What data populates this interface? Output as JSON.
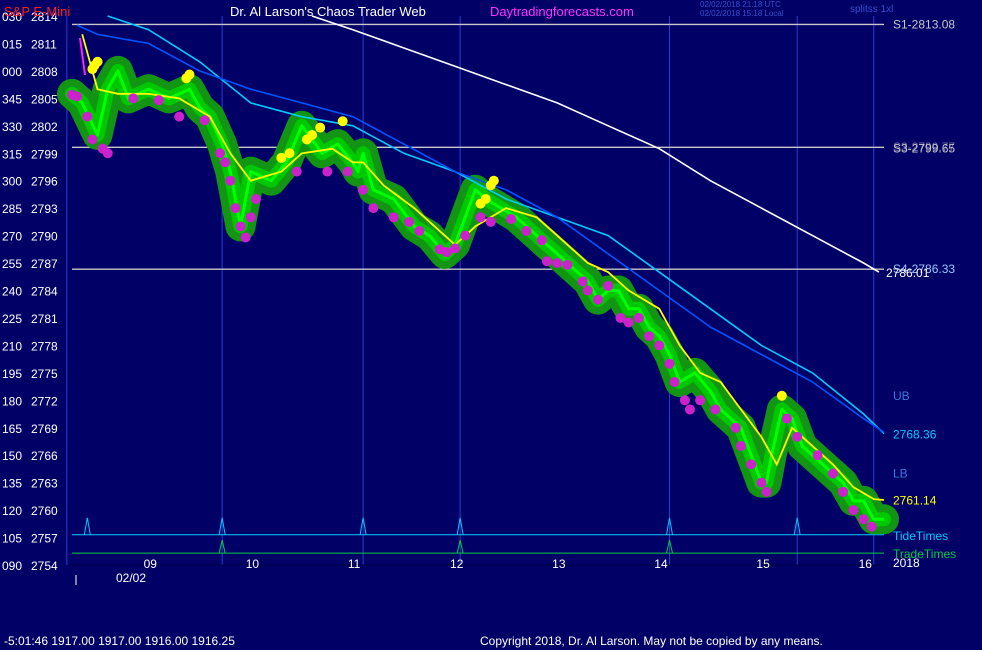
{
  "header": {
    "instrument": "S&P E-Mini",
    "title": "Dr. Al Larson's Chaos Trader Web",
    "site": "Daytradingforecasts.com",
    "timestamp_utc": "02/02/2018 21:18 UTC",
    "timestamp_local": "02/02/2018 15:18 Local",
    "corner_label": "splitss 1xl"
  },
  "footer": {
    "quote": "-5:01:46  1917.00 1917.00 1916.00 1916.25",
    "copyright": "Copyright 2018, Dr. Al Larson. May not be copied by any means."
  },
  "colors": {
    "background": "#000066",
    "price": "#00ff00",
    "glow": "#129512",
    "ema": "#ffff00",
    "upper_band": "#00ccff",
    "lower_band": "#0055ff",
    "slow_ma": "#ffffff",
    "dots_low": "#cc22cc",
    "dots_high": "#ffff00",
    "level_lines": "#c8c8c8",
    "tide": "#00ccff",
    "trade": "#00cc44",
    "grid": "#2a3fd0"
  },
  "chart_data": {
    "type": "line",
    "y_axis": {
      "range": [
        2754,
        2814
      ],
      "ticks": [
        2814,
        2811,
        2808,
        2805,
        2802,
        2799,
        2796,
        2793,
        2790,
        2787,
        2784,
        2781,
        2778,
        2775,
        2772,
        2769,
        2766,
        2763,
        2760,
        2757,
        2754
      ],
      "secondary_labels": [
        "030",
        "015",
        "000",
        "345",
        "330",
        "315",
        "300",
        "285",
        "270",
        "255",
        "240",
        "225",
        "210",
        "195",
        "180",
        "165",
        "150",
        "135",
        "120",
        "105",
        "090"
      ]
    },
    "x_axis": {
      "range": [
        8.25,
        16.2
      ],
      "hour_labels": [
        "09",
        "10",
        "11",
        "12",
        "13",
        "14",
        "15",
        "16"
      ],
      "date_label": "02/02",
      "year_label": "2018"
    },
    "vertical_lines": [
      8.2,
      9.72,
      11.1,
      12.05,
      14.1,
      15.35,
      16.1
    ],
    "tide_times": [
      8.4,
      9.72,
      11.1,
      12.05,
      14.1,
      15.35
    ],
    "trade_times": [
      9.72,
      12.05,
      14.1
    ],
    "levels": [
      {
        "label": "S1-2813.08",
        "value": 2813.08,
        "color": "#c8c8c8"
      },
      {
        "label": "S3-2799.65",
        "value": 2799.65,
        "color": "#c8c8c8"
      },
      {
        "label": "S3-2799.77",
        "value": 2799.77,
        "color": "#c8c8c8"
      },
      {
        "label": "S4-2786.33",
        "value": 2786.33,
        "color": "#9ac8ff"
      }
    ],
    "right_labels": [
      {
        "text": "2786.01",
        "value": 2786.01,
        "color": "#ffffff"
      },
      {
        "text": "UB",
        "value": 2772.6,
        "color": "#3a7ad8"
      },
      {
        "text": "2768.36",
        "value": 2768.36,
        "color": "#00ccff"
      },
      {
        "text": "LB",
        "value": 2764.1,
        "color": "#3a7ad8"
      },
      {
        "text": "2761.14",
        "value": 2761.14,
        "color": "#ffff00"
      },
      {
        "text": "TideTimes",
        "value": 2757.3,
        "color": "#00ccff"
      },
      {
        "text": "TradeTimes",
        "value": 2755.3,
        "color": "#00cc44"
      }
    ],
    "series": [
      {
        "name": "price",
        "x": [
          8.25,
          8.35,
          8.5,
          8.6,
          8.7,
          8.8,
          9.0,
          9.2,
          9.4,
          9.5,
          9.6,
          9.72,
          9.8,
          9.85,
          9.9,
          10.0,
          10.2,
          10.35,
          10.5,
          10.7,
          10.85,
          11.0,
          11.05,
          11.1,
          11.2,
          11.4,
          11.6,
          11.75,
          11.9,
          12.0,
          12.1,
          12.2,
          12.3,
          12.45,
          12.6,
          12.7,
          12.8,
          12.9,
          13.0,
          13.1,
          13.2,
          13.3,
          13.4,
          13.5,
          13.6,
          13.7,
          13.8,
          13.9,
          14.0,
          14.1,
          14.2,
          14.35,
          14.5,
          14.6,
          14.7,
          14.8,
          14.9,
          15.0,
          15.05,
          15.1,
          15.2,
          15.3,
          15.4,
          15.5,
          15.6,
          15.7,
          15.8,
          15.9,
          16.0,
          16.1,
          16.2
        ],
        "values": [
          2805.5,
          2804.5,
          2801,
          2806,
          2808,
          2805,
          2806,
          2805,
          2806,
          2804,
          2803,
          2800,
          2797,
          2794,
          2791,
          2797,
          2796,
          2798,
          2802,
          2799,
          2800,
          2798,
          2797,
          2799,
          2795,
          2794,
          2791,
          2790,
          2788,
          2789,
          2792,
          2795,
          2794,
          2793,
          2792,
          2791,
          2790,
          2789,
          2788,
          2787,
          2786,
          2785,
          2783,
          2784,
          2784,
          2782,
          2782,
          2780,
          2779,
          2777,
          2774,
          2775,
          2773,
          2771,
          2770,
          2769,
          2766,
          2763,
          2763,
          2766,
          2771,
          2770,
          2767,
          2766,
          2765,
          2764,
          2763,
          2761,
          2761,
          2759,
          2759
        ]
      },
      {
        "name": "ema",
        "x": [
          8.35,
          8.5,
          8.7,
          9.0,
          9.3,
          9.6,
          9.8,
          10.0,
          10.3,
          10.5,
          10.8,
          11.0,
          11.1,
          11.3,
          11.6,
          11.8,
          12.0,
          12.2,
          12.5,
          12.8,
          13.0,
          13.3,
          13.5,
          13.7,
          14.0,
          14.2,
          14.4,
          14.6,
          14.8,
          15.0,
          15.15,
          15.3,
          15.5,
          15.7,
          15.9,
          16.1,
          16.2
        ],
        "values": [
          2812,
          2806,
          2805.5,
          2805.5,
          2805,
          2803,
          2799,
          2796,
          2797,
          2799,
          2799.5,
          2798,
          2798,
          2795.5,
          2793,
          2791,
          2789,
          2791,
          2793,
          2792,
          2790,
          2787,
          2786,
          2784,
          2782,
          2778,
          2775,
          2774,
          2771,
          2768,
          2765,
          2769,
          2767,
          2765,
          2762.5,
          2761.2,
          2761.1
        ]
      },
      {
        "name": "upper_band",
        "x": [
          8.6,
          9.0,
          9.5,
          10.0,
          10.5,
          11.0,
          11.5,
          12.0,
          12.5,
          13.0,
          13.5,
          14.0,
          14.5,
          15.0,
          15.5,
          16.0,
          16.2
        ],
        "values": [
          2814,
          2812.5,
          2809,
          2804.5,
          2803,
          2802,
          2799,
          2797,
          2794,
          2792,
          2790,
          2786,
          2782,
          2778,
          2775,
          2770.5,
          2768.36
        ]
      },
      {
        "name": "lower_band",
        "x": [
          8.3,
          8.5,
          9.0,
          9.5,
          10.0,
          10.5,
          11.0,
          11.5,
          12.0,
          12.5,
          13.0,
          13.5,
          14.0,
          14.5,
          15.0,
          15.5,
          16.0,
          16.2
        ],
        "values": [
          2813,
          2812,
          2811,
          2808,
          2806,
          2804.5,
          2803,
          2800,
          2797,
          2795,
          2792,
          2788,
          2784,
          2780,
          2777,
          2774,
          2770,
          2768.5
        ]
      },
      {
        "name": "slow_ma",
        "x": [
          10.6,
          11.0,
          11.5,
          12.0,
          12.5,
          13.0,
          13.5,
          14.0,
          14.5,
          15.0,
          15.5,
          16.0,
          16.15
        ],
        "values": [
          2814,
          2812.5,
          2810.5,
          2808.5,
          2806.5,
          2804.5,
          2802,
          2799.5,
          2796,
          2793,
          2790,
          2787,
          2786.01
        ]
      }
    ],
    "yellow_dots": [
      {
        "x": 8.45,
        "y": 2808.2
      },
      {
        "x": 8.5,
        "y": 2809
      },
      {
        "x": 8.47,
        "y": 2808.6
      },
      {
        "x": 9.4,
        "y": 2807.6
      },
      {
        "x": 9.37,
        "y": 2807.2
      },
      {
        "x": 10.3,
        "y": 2798.5
      },
      {
        "x": 10.38,
        "y": 2799
      },
      {
        "x": 10.55,
        "y": 2800.5
      },
      {
        "x": 10.6,
        "y": 2801
      },
      {
        "x": 10.68,
        "y": 2801.8
      },
      {
        "x": 10.9,
        "y": 2802.5
      },
      {
        "x": 12.25,
        "y": 2793.5
      },
      {
        "x": 12.3,
        "y": 2794
      },
      {
        "x": 12.35,
        "y": 2795.5
      },
      {
        "x": 12.38,
        "y": 2796
      },
      {
        "x": 15.2,
        "y": 2772.5
      }
    ],
    "purple_dots": [
      {
        "x": 8.25,
        "y": 2805.4
      },
      {
        "x": 8.3,
        "y": 2805.2
      },
      {
        "x": 8.4,
        "y": 2803
      },
      {
        "x": 8.45,
        "y": 2800.5
      },
      {
        "x": 8.55,
        "y": 2799.5
      },
      {
        "x": 8.6,
        "y": 2799
      },
      {
        "x": 8.85,
        "y": 2805
      },
      {
        "x": 9.1,
        "y": 2804.8
      },
      {
        "x": 9.3,
        "y": 2803
      },
      {
        "x": 9.55,
        "y": 2802.6
      },
      {
        "x": 9.7,
        "y": 2799
      },
      {
        "x": 9.75,
        "y": 2798
      },
      {
        "x": 9.8,
        "y": 2796
      },
      {
        "x": 9.85,
        "y": 2793
      },
      {
        "x": 9.9,
        "y": 2791
      },
      {
        "x": 9.95,
        "y": 2789.8
      },
      {
        "x": 10.0,
        "y": 2792
      },
      {
        "x": 10.05,
        "y": 2794
      },
      {
        "x": 10.45,
        "y": 2797
      },
      {
        "x": 10.75,
        "y": 2797
      },
      {
        "x": 10.95,
        "y": 2797
      },
      {
        "x": 11.1,
        "y": 2795
      },
      {
        "x": 11.2,
        "y": 2793
      },
      {
        "x": 11.4,
        "y": 2792
      },
      {
        "x": 11.55,
        "y": 2791.5
      },
      {
        "x": 11.65,
        "y": 2790.5
      },
      {
        "x": 11.85,
        "y": 2788.5
      },
      {
        "x": 11.92,
        "y": 2788.2
      },
      {
        "x": 12.0,
        "y": 2788.6
      },
      {
        "x": 12.1,
        "y": 2790
      },
      {
        "x": 12.25,
        "y": 2792
      },
      {
        "x": 12.35,
        "y": 2791.5
      },
      {
        "x": 12.55,
        "y": 2791.8
      },
      {
        "x": 12.7,
        "y": 2790.5
      },
      {
        "x": 12.85,
        "y": 2789.5
      },
      {
        "x": 12.9,
        "y": 2787.2
      },
      {
        "x": 13.0,
        "y": 2787
      },
      {
        "x": 13.1,
        "y": 2786.8
      },
      {
        "x": 13.25,
        "y": 2785
      },
      {
        "x": 13.3,
        "y": 2784
      },
      {
        "x": 13.4,
        "y": 2783
      },
      {
        "x": 13.5,
        "y": 2784.5
      },
      {
        "x": 13.62,
        "y": 2781
      },
      {
        "x": 13.7,
        "y": 2780.5
      },
      {
        "x": 13.8,
        "y": 2781
      },
      {
        "x": 13.9,
        "y": 2779
      },
      {
        "x": 14.0,
        "y": 2778
      },
      {
        "x": 14.1,
        "y": 2776
      },
      {
        "x": 14.15,
        "y": 2774
      },
      {
        "x": 14.25,
        "y": 2772
      },
      {
        "x": 14.3,
        "y": 2771
      },
      {
        "x": 14.4,
        "y": 2772
      },
      {
        "x": 14.55,
        "y": 2771
      },
      {
        "x": 14.75,
        "y": 2769
      },
      {
        "x": 14.8,
        "y": 2767
      },
      {
        "x": 14.9,
        "y": 2765
      },
      {
        "x": 15.0,
        "y": 2763
      },
      {
        "x": 15.05,
        "y": 2762
      },
      {
        "x": 15.25,
        "y": 2770
      },
      {
        "x": 15.35,
        "y": 2768
      },
      {
        "x": 15.55,
        "y": 2766
      },
      {
        "x": 15.7,
        "y": 2764
      },
      {
        "x": 15.8,
        "y": 2762
      },
      {
        "x": 15.9,
        "y": 2760
      },
      {
        "x": 16.0,
        "y": 2759
      },
      {
        "x": 16.08,
        "y": 2758.2
      }
    ]
  }
}
